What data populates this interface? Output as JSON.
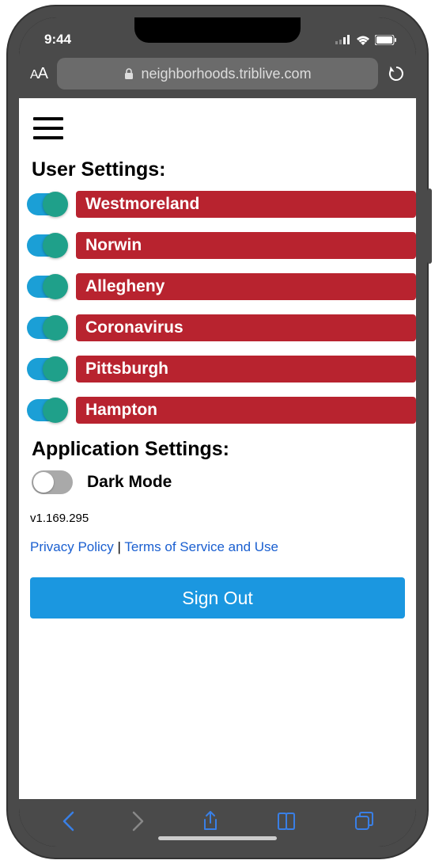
{
  "status": {
    "time": "9:44"
  },
  "browser": {
    "domain": "neighborhoods.triblive.com"
  },
  "page": {
    "user_settings_title": "User Settings:",
    "topics": [
      {
        "label": "Westmoreland",
        "enabled": true
      },
      {
        "label": "Norwin",
        "enabled": true
      },
      {
        "label": "Allegheny",
        "enabled": true
      },
      {
        "label": "Coronavirus",
        "enabled": true
      },
      {
        "label": "Pittsburgh",
        "enabled": true
      },
      {
        "label": "Hampton",
        "enabled": true
      }
    ],
    "app_settings_title": "Application Settings:",
    "dark_mode_label": "Dark Mode",
    "dark_mode_enabled": false,
    "version": "v1.169.295",
    "privacy_label": "Privacy Policy",
    "link_sep": " | ",
    "tos_label": "Terms of Service and Use",
    "signout_label": "Sign Out"
  }
}
